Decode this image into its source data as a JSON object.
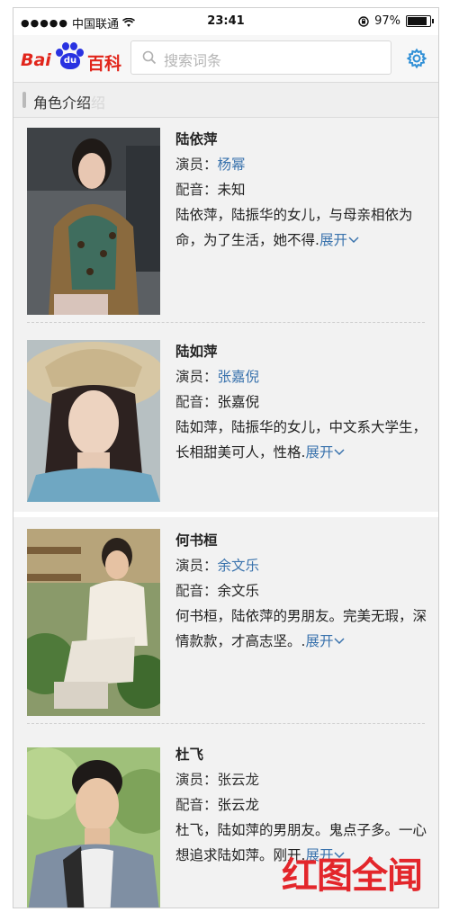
{
  "status_bar": {
    "carrier": "中国联通",
    "signal_dots": "●●●●●",
    "time": "23:41",
    "battery_pct": "97%"
  },
  "header": {
    "logo": {
      "bai": "Bai",
      "du": "du",
      "baike": "百科"
    },
    "search": {
      "placeholder": "搜索词条",
      "icon": "search-icon"
    },
    "settings_icon": "gear-icon"
  },
  "section": {
    "title": "角色介绍",
    "ghost_text": "绍"
  },
  "characters": [
    {
      "name": "陆依萍",
      "actor_label": "演员：",
      "actor": "杨幂",
      "voice_label": "配音：",
      "voice": "未知",
      "desc": "陆依萍，陆振华的女儿，与母亲相依为命，为了生活，她不得.",
      "expand": "展开"
    },
    {
      "name": "陆如萍",
      "actor_label": "演员：",
      "actor": "张嘉倪",
      "voice_label": "配音：",
      "voice": "张嘉倪",
      "desc": "陆如萍，陆振华的女儿，中文系大学生，长相甜美可人，性格.",
      "expand": "展开"
    },
    {
      "name": "何书桓",
      "actor_label": "演员：",
      "actor": "余文乐",
      "voice_label": "配音：",
      "voice": "余文乐",
      "desc": "何书桓，陆依萍的男朋友。完美无瑕，深情款款，才高志坚。.",
      "expand": "展开"
    },
    {
      "name": "杜飞",
      "actor_label": "演员：",
      "actor": "张云龙",
      "voice_label": "配音：",
      "voice": "张云龙",
      "desc": "杜飞，陆如萍的男朋友。鬼点子多。一心想追求陆如萍。刚开.",
      "expand": "展开"
    }
  ],
  "watermark": "红图全闻",
  "colors": {
    "link": "#3a73ad",
    "brand_red": "#e1251b",
    "brand_blue": "#2932e1"
  }
}
